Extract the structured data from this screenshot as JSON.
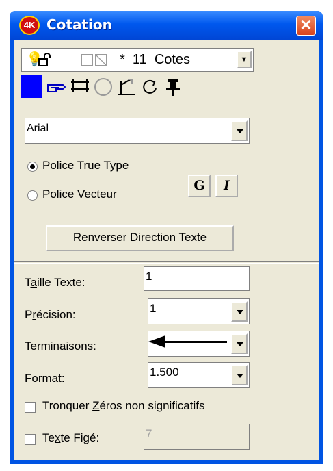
{
  "window": {
    "title": "Cotation",
    "app_icon": "4K"
  },
  "counter": {
    "star": "*",
    "number": "11",
    "label": "Cotes"
  },
  "font": {
    "value": "Arial"
  },
  "radio": {
    "true_type": {
      "pre": "Police Tr",
      "mn": "u",
      "post": "e Type"
    },
    "vector": {
      "pre": "Police ",
      "mn": "V",
      "post": "ecteur"
    }
  },
  "style_buttons": {
    "bold": "G",
    "italic": "I"
  },
  "reverse_button": {
    "pre": "Renverser ",
    "mn": "D",
    "post": "irection Texte"
  },
  "fields": {
    "taille": {
      "pre": "T",
      "mn": "a",
      "post": "ille Texte:",
      "value": "1"
    },
    "precision": {
      "pre": "P",
      "mn": "r",
      "post": "écision:",
      "value": "1"
    },
    "terminaisons": {
      "pre": "",
      "mn": "T",
      "post": "erminaisons:"
    },
    "format": {
      "pre": "",
      "mn": "F",
      "post": "ormat:",
      "value": "1.500"
    }
  },
  "checkboxes": {
    "tronquer": {
      "pre": "Tronquer ",
      "mn": "Z",
      "post": "éros non significatifs",
      "checked": false
    },
    "texte_fige": {
      "pre": "Te",
      "mn": "x",
      "post": "te Figé:",
      "value": "7",
      "checked": false
    }
  },
  "colors": {
    "titlebar": "#0054e3",
    "client": "#ece9d8",
    "swatch": "#0000ff"
  }
}
